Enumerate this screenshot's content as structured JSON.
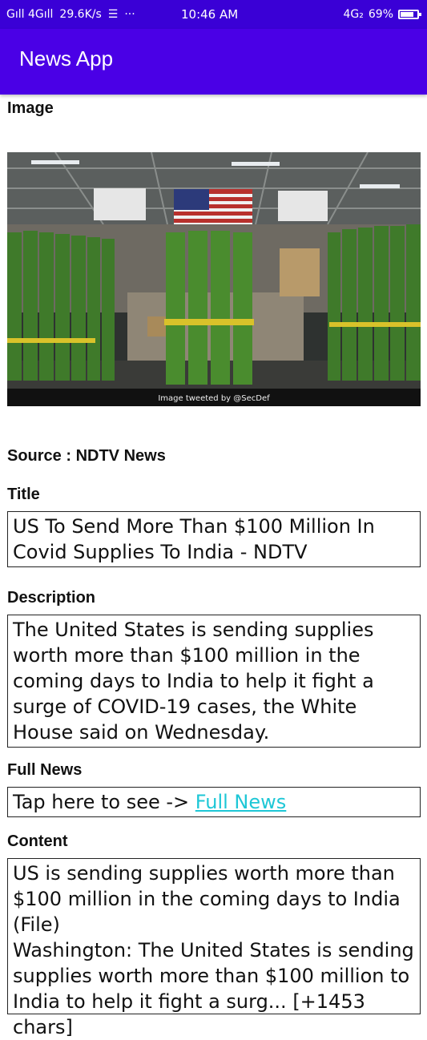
{
  "status_bar": {
    "signal_left": "Gıll 4Gıll",
    "speed": "29.6K/s",
    "dots": "···",
    "time": "10:46 AM",
    "network": "4G₂",
    "battery": "69%"
  },
  "app": {
    "title": "News App"
  },
  "image_section": {
    "label": "Image",
    "caption": "Image tweeted by @SecDef"
  },
  "source": {
    "text": "Source : NDTV News"
  },
  "title_section": {
    "label": "Title",
    "value": "US To Send More Than $100 Million In Covid Supplies To India - NDTV"
  },
  "description_section": {
    "label": "Description",
    "value": "The United States is sending supplies worth more than $100 million in the coming days to India to help it fight a surge of COVID-19 cases, the White House said on Wednesday."
  },
  "full_news_section": {
    "label": "Full News",
    "prefix": "Tap here to see -> ",
    "link_text": "Full News"
  },
  "content_section": {
    "label": "Content",
    "line1": "US is sending supplies worth more than $100 million in the coming days to India (File)",
    "line2": "Washington: The United States is sending supplies worth more than $100 million to India to help it fight a surg... [+1453 chars]"
  }
}
